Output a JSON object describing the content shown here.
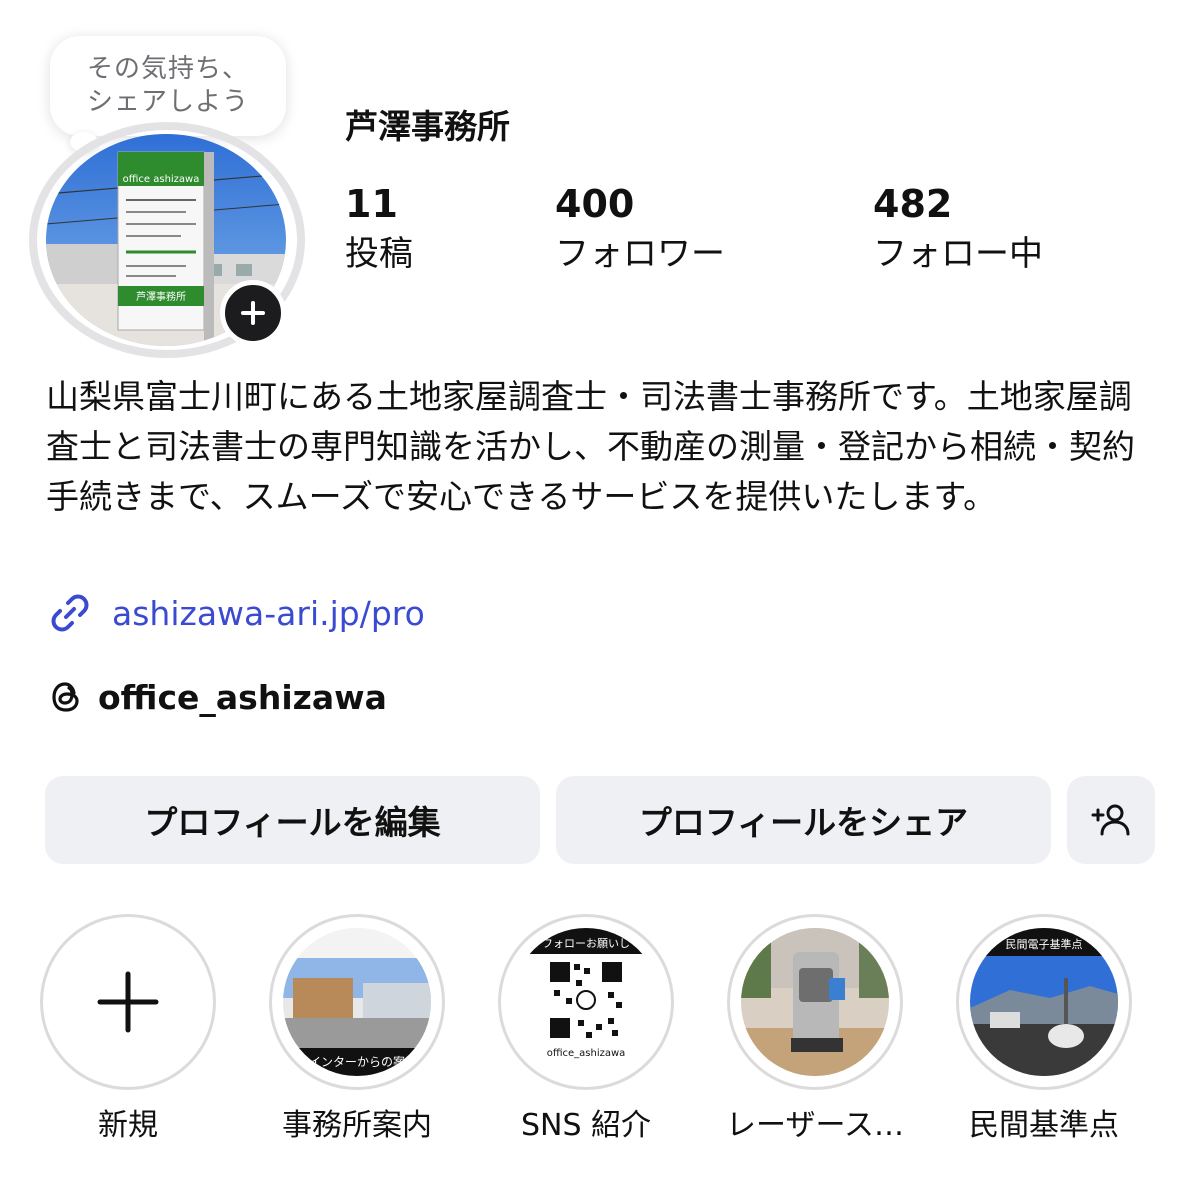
{
  "note": {
    "line1": "その気持ち、",
    "line2": "シェアしよう"
  },
  "profile": {
    "name": "芦澤事務所",
    "avatar_sign_text": "芦澤事務所",
    "avatar_sign_brand": "office ashizawa"
  },
  "stats": [
    {
      "value": "11",
      "label": "投稿"
    },
    {
      "value": "400",
      "label": "フォロワー"
    },
    {
      "value": "482",
      "label": "フォロー中"
    }
  ],
  "bio": {
    "text": "山梨県富士川町にある土地家屋調査士・司法書士事務所です。土地家屋調査士と司法書士の専門知識を活かし、不動産の測量・登記から相続・契約手続きまで、スムーズで安心できるサービスを提供いたします。"
  },
  "link": {
    "url": "ashizawa-ari.jp/pro",
    "icon": "link-icon"
  },
  "threads": {
    "handle": "office_ashizawa",
    "icon": "threads-icon"
  },
  "buttons": {
    "edit_label": "プロフィールを編集",
    "share_label": "プロフィールをシェア",
    "discover_icon": "add-person-icon"
  },
  "highlights": [
    {
      "label": "新規",
      "icon": "plus-icon"
    },
    {
      "label": "事務所案内",
      "overlay": "インターからの案"
    },
    {
      "label": "SNS 紹介",
      "top_text": "フォローお願いし",
      "caption": "office_ashizawa"
    },
    {
      "label": "レーザース…"
    },
    {
      "label": "民間基準点",
      "top_text": "民間電子基準点"
    }
  ],
  "colors": {
    "link": "#3a4bd1",
    "button_bg": "#eff0f3",
    "sign_green": "#2e8b2e",
    "ring_gray": "#dbdbdb"
  }
}
